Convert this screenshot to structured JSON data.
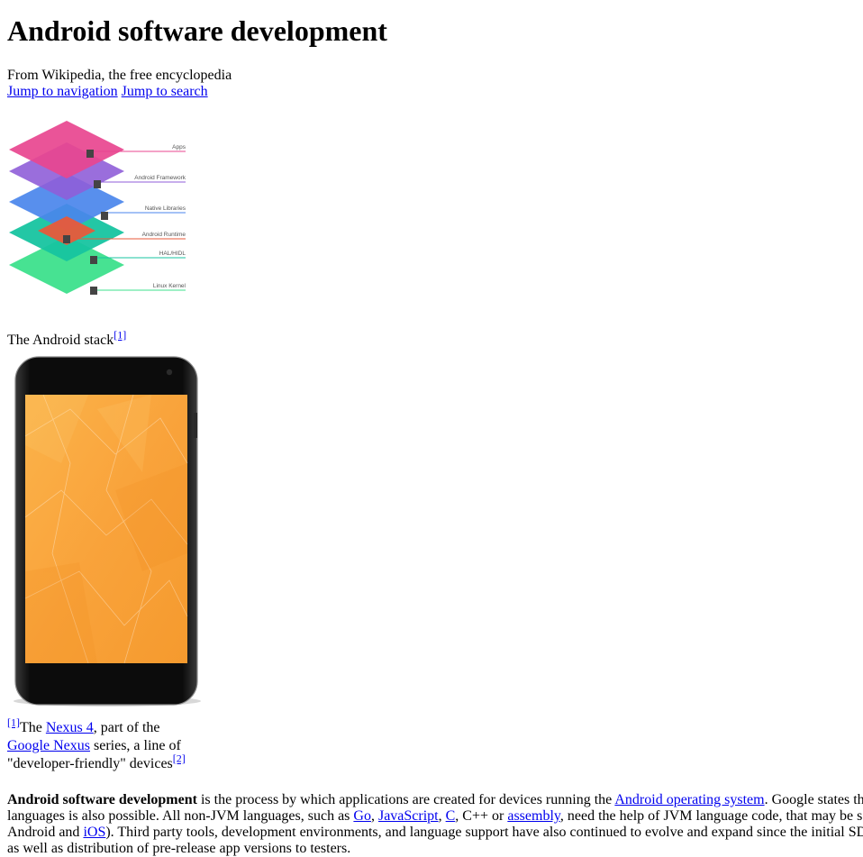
{
  "title": "Android software development",
  "tagline": "From Wikipedia, the free encyclopedia",
  "jump_links": {
    "navigation": "Jump to navigation",
    "search": "Jump to search"
  },
  "stack_figure": {
    "layers": [
      {
        "label": "Apps",
        "color": "#e8458f"
      },
      {
        "label": "Android Framework",
        "color": "#8f5ed8"
      },
      {
        "label": "Native Libraries",
        "color": "#4a85ec"
      },
      {
        "label": "Android Runtime",
        "color": "#e85a3a"
      },
      {
        "label": "HAL/HIDL",
        "color": "#17c4a0"
      },
      {
        "label": "Linux Kernel",
        "color": "#3de08c"
      }
    ],
    "caption": "The Android stack",
    "caption_ref": "[1]"
  },
  "phone_figure": {
    "device_icon": "phone-image",
    "screen_color": "#f9a33b",
    "caption_ref": "[1]",
    "caption_prefix": "The ",
    "caption_link1": "Nexus 4",
    "caption_mid": ", part of the ",
    "caption_link2": "Google Nexus",
    "caption_suffix": " series, a line of \"developer-friendly\" devices",
    "caption_ref2": "[2]"
  },
  "intro": {
    "bold": "Android software development",
    "t1": " is the process by which applications are created for devices running the ",
    "link_os": "Android operating system",
    "t2": ". Google states th",
    "t3": "languages is also possible. All non-JVM languages, such as ",
    "link_go": "Go",
    "sep1": ", ",
    "link_js": "JavaScript",
    "sep2": ", ",
    "link_c": "C",
    "t4": ", C++ or ",
    "link_asm": "assembly",
    "t5": ", need the help of JVM language code, that may be s",
    "t6": "Android and ",
    "link_ios": "iOS",
    "t7": "). Third party tools, development environments, and language support have also continued to evolve and expand since the initial SD",
    "t8": "as well as distribution of pre-release app versions to testers."
  }
}
